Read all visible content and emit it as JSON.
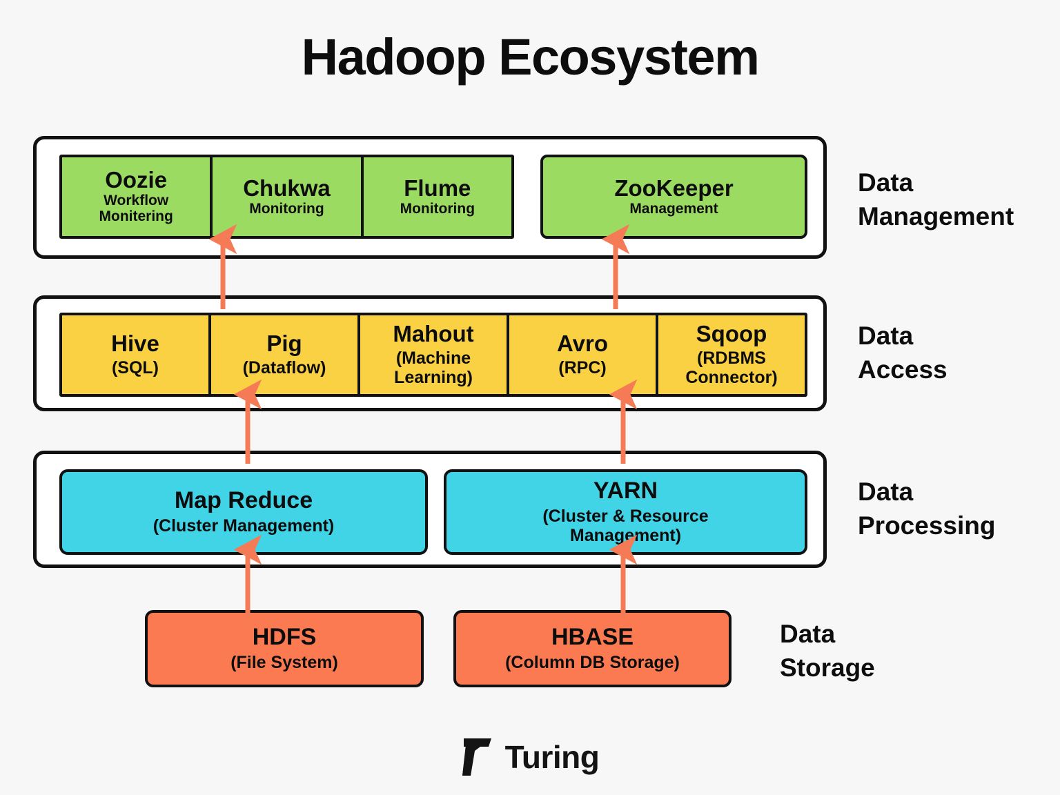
{
  "page": {
    "title": "Hadoop Ecosystem",
    "background_color": "#F7F7F7"
  },
  "colors": {
    "management_fill": "#9CDB61",
    "access_fill": "#FBD144",
    "processing_fill": "#41D4E7",
    "storage_fill": "#FB7A51",
    "arrow": "#F47B55",
    "border": "#111111",
    "shell_fill": "#FFFFFF",
    "text": "#0D0D0D"
  },
  "layers": {
    "management": {
      "label": "Data\nManagement",
      "group": [
        {
          "name": "Oozie",
          "sub": "Workflow\nMonitering"
        },
        {
          "name": "Chukwa",
          "sub": "Monitoring"
        },
        {
          "name": "Flume",
          "sub": "Monitoring"
        }
      ],
      "standalone": {
        "name": "ZooKeeper",
        "sub": "Management"
      }
    },
    "access": {
      "label": "Data\nAccess",
      "items": [
        {
          "name": "Hive",
          "sub": "(SQL)"
        },
        {
          "name": "Pig",
          "sub": "(Dataflow)"
        },
        {
          "name": "Mahout",
          "sub": "(Machine\nLearning)"
        },
        {
          "name": "Avro",
          "sub": "(RPC)"
        },
        {
          "name": "Sqoop",
          "sub": "(RDBMS\nConnector)"
        }
      ]
    },
    "processing": {
      "label": "Data\nProcessing",
      "items": [
        {
          "name": "Map Reduce",
          "sub": "(Cluster Management)"
        },
        {
          "name": "YARN",
          "sub": "(Cluster & Resource\nManagement)"
        }
      ]
    },
    "storage": {
      "label": "Data\nStorage",
      "items": [
        {
          "name": "HDFS",
          "sub": "(File System)"
        },
        {
          "name": "HBASE",
          "sub": "(Column DB Storage)"
        }
      ]
    }
  },
  "connectors": [
    {
      "from": "Pig",
      "to": "Oozie group",
      "direction": "up"
    },
    {
      "from": "Avro",
      "to": "ZooKeeper",
      "direction": "up"
    },
    {
      "from": "Map Reduce",
      "to": "Pig",
      "direction": "up"
    },
    {
      "from": "YARN",
      "to": "Avro",
      "direction": "up"
    },
    {
      "from": "HDFS",
      "to": "Map Reduce",
      "direction": "up"
    },
    {
      "from": "HBASE",
      "to": "YARN",
      "direction": "up"
    }
  ],
  "footer": {
    "logo_mark": "turing-seven-mark",
    "wordmark": "Turing"
  }
}
